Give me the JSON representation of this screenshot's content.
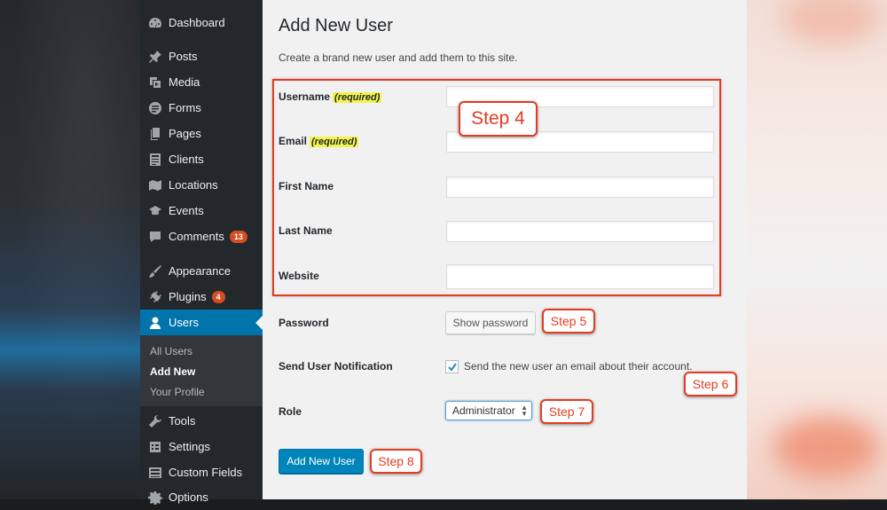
{
  "sidebar": {
    "items": [
      {
        "label": "Dashboard",
        "icon": "dashboard-icon"
      },
      {
        "label": "Posts",
        "icon": "pin-icon"
      },
      {
        "label": "Media",
        "icon": "media-icon"
      },
      {
        "label": "Forms",
        "icon": "forms-icon"
      },
      {
        "label": "Pages",
        "icon": "pages-icon"
      },
      {
        "label": "Clients",
        "icon": "clients-icon"
      },
      {
        "label": "Locations",
        "icon": "location-icon"
      },
      {
        "label": "Events",
        "icon": "events-icon"
      },
      {
        "label": "Comments",
        "icon": "comment-icon",
        "badge": "13"
      },
      {
        "label": "Appearance",
        "icon": "brush-icon"
      },
      {
        "label": "Plugins",
        "icon": "plug-icon",
        "badge": "4"
      },
      {
        "label": "Users",
        "icon": "user-icon",
        "active": true
      },
      {
        "label": "Tools",
        "icon": "wrench-icon"
      },
      {
        "label": "Settings",
        "icon": "settings-icon"
      },
      {
        "label": "Custom Fields",
        "icon": "custom-fields-icon"
      },
      {
        "label": "Options",
        "icon": "gear-icon"
      }
    ],
    "submenu": [
      {
        "label": "All Users"
      },
      {
        "label": "Add New",
        "current": true
      },
      {
        "label": "Your Profile"
      }
    ]
  },
  "page": {
    "title": "Add New User",
    "description": "Create a brand new user and add them to this site."
  },
  "form": {
    "required_tag": "(required)",
    "username_label": "Username",
    "email_label": "Email",
    "first_name_label": "First Name",
    "last_name_label": "Last Name",
    "website_label": "Website",
    "password_label": "Password",
    "show_password_button": "Show password",
    "notification_label": "Send User Notification",
    "notification_checkbox_label": "Send the new user an email about their account.",
    "notification_checked": true,
    "role_label": "Role",
    "role_value": "Administrator",
    "submit_button": "Add New User",
    "username_value": "",
    "email_value": "",
    "first_name_value": "",
    "last_name_value": "",
    "website_value": ""
  },
  "annotations": {
    "step4": "Step 4",
    "step5": "Step 5",
    "step6": "Step 6",
    "step7": "Step 7",
    "step8": "Step 8"
  },
  "colors": {
    "sidebar_bg": "#23282d",
    "active_menu": "#0073aa",
    "badge": "#d54e21",
    "primary_button": "#0085ba",
    "annotation_red": "#e53b22",
    "required_highlight": "#f2f44d"
  }
}
